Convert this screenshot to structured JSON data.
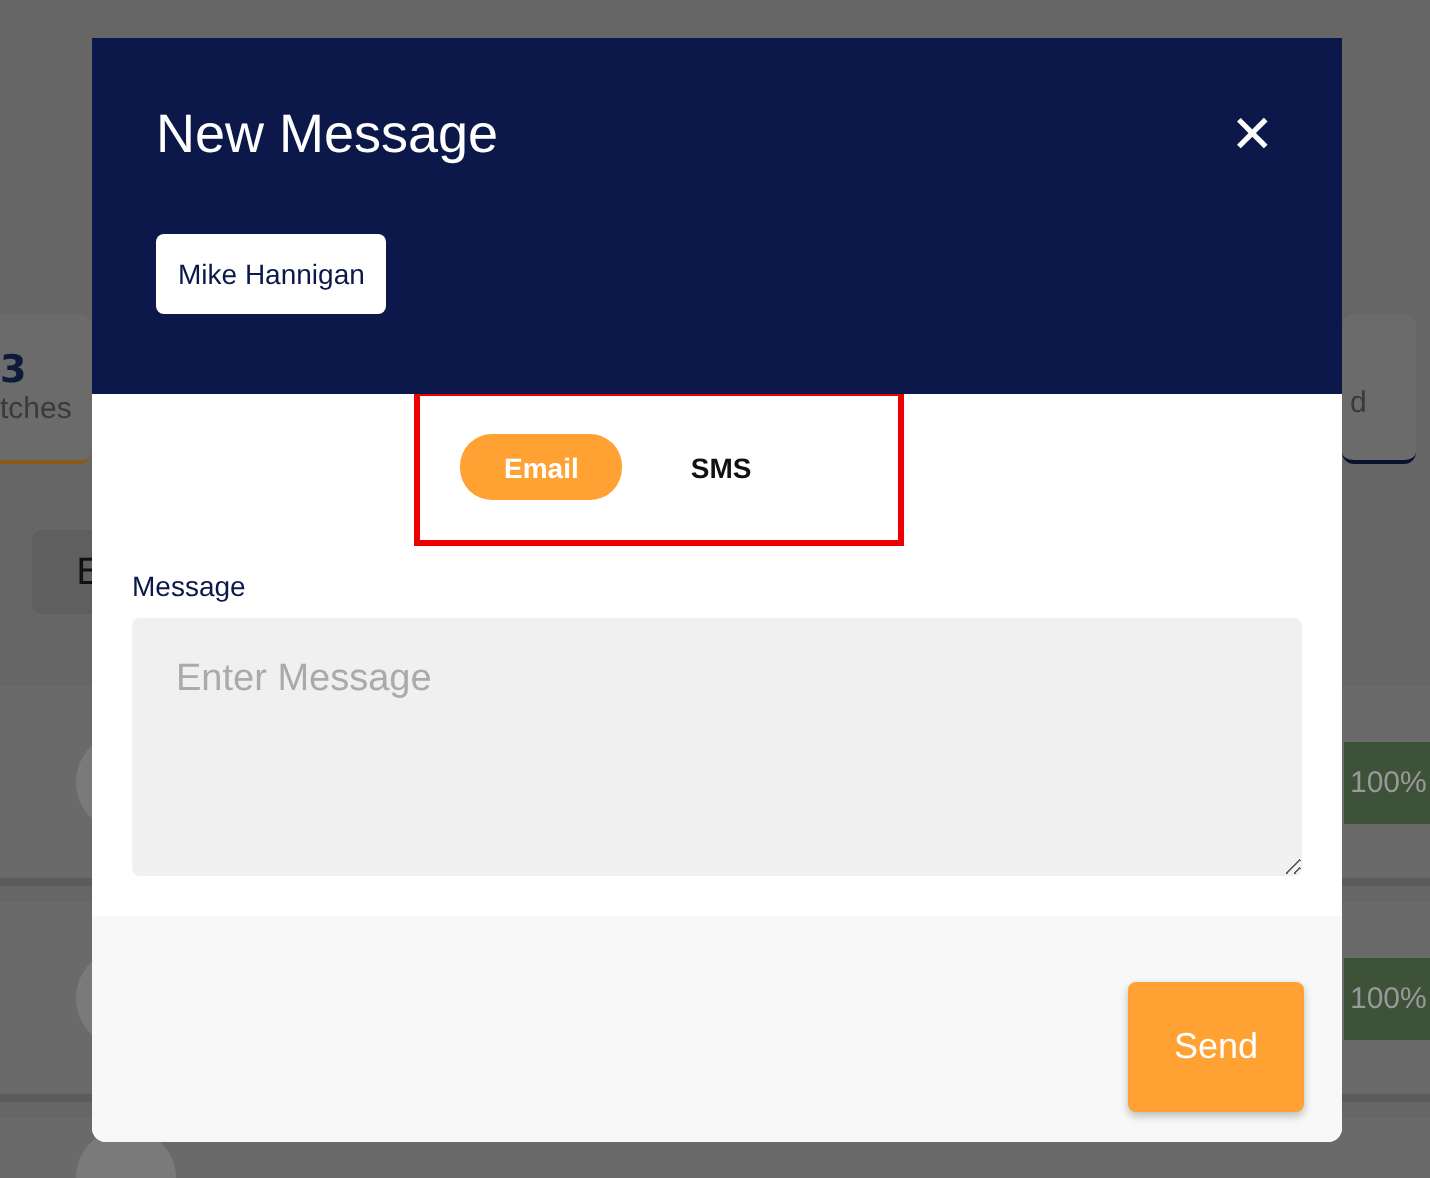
{
  "background": {
    "stat_left": {
      "value": "3",
      "label": "tches"
    },
    "stat_right": {
      "label": "d"
    },
    "button": "E",
    "rows": [
      {
        "badge": "100%"
      },
      {
        "badge": "100%"
      }
    ]
  },
  "modal": {
    "title": "New Message",
    "close": "✕",
    "recipient": "Mike Hannigan",
    "channels": [
      {
        "label": "Email",
        "selected": true
      },
      {
        "label": "SMS",
        "selected": false
      }
    ],
    "message": {
      "label": "Message",
      "placeholder": "Enter Message"
    },
    "send": "Send"
  }
}
